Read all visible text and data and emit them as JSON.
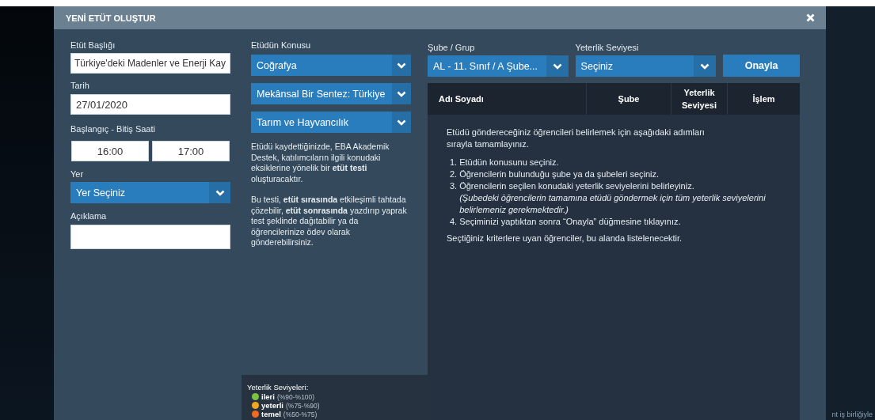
{
  "dialog": {
    "title": "YENİ ETÜT OLUŞTUR"
  },
  "form": {
    "title_field": {
      "label": "Etüt Başlığı",
      "value": "Türkiye'deki Madenler ve Enerji Kay"
    },
    "date_field": {
      "label": "Tarih",
      "value": "27/01/2020"
    },
    "time": {
      "label": "Başlangıç - Bitiş Saati",
      "start": "16:00",
      "end": "17:00"
    },
    "place": {
      "label": "Yer",
      "value": "Yer Seçiniz"
    },
    "description": {
      "label": "Açıklama"
    }
  },
  "topic": {
    "label": "Etüdün Konusu",
    "selects": [
      "Coğrafya",
      "Mekânsal Bir Sentez: Türkiye",
      "Tarım ve Hayvancılık"
    ],
    "info_paragraphs": [
      "Etüdü kaydettiğinizde, EBA Akademik Destek, katılımcıların ilgili konudaki eksiklerine yönelik bir **etüt testi** oluşturacaktır.",
      "Bu testi, **etüt sırasında** etkileşimli tahtada çözebilir, **etüt sonrasında** yazdırıp yaprak test şeklinde dağıtabilir ya da öğrencilerinize ödev olarak gönderebilirsiniz."
    ]
  },
  "filters": {
    "group": {
      "label": "Şube / Grup",
      "value": "AL - 11. Sınıf / A Şube..."
    },
    "level": {
      "label": "Yeterlik Seviyesi",
      "value": "Seçiniz"
    },
    "confirm_button": "Onayla"
  },
  "table": {
    "columns": [
      "Adı Soyadı",
      "Şube",
      "Yeterlik Seviyesi",
      "İşlem"
    ],
    "empty_message": {
      "intro": "Etüdü göndereceğiniz öğrencileri belirlemek için aşağıdaki adımları sırayla tamamlayınız.",
      "steps": [
        {
          "number": "1.",
          "text": "Etüdün konusunu seçiniz."
        },
        {
          "number": "2.",
          "text": "Öğrencilerin bulunduğu şube ya da şubeleri seçiniz."
        },
        {
          "number": "3.",
          "text": "Öğrencilerin seçilen konudaki yeterlik seviyelerini belirleyiniz.",
          "note": "(Şubedeki öğrencilerin tamamına etüdü göndermek için tüm yeterlik seviyelerini belirlemeniz gerekmektedir.)"
        },
        {
          "number": "4.",
          "text": "Seçiminizi yaptıktan sonra “Onayla” düğmesine tıklayınız."
        }
      ],
      "outro": "Seçtiğiniz kriterlere uyan öğrenciler, bu alanda listelenecektir."
    }
  },
  "legend": {
    "title": "Yeterlik Seviyeleri:",
    "items": [
      {
        "name": "ileri",
        "range": "(%90-%100)",
        "color": "#7cc242"
      },
      {
        "name": "yeterli",
        "range": "(%75-%90)",
        "color": "#f0a81e"
      },
      {
        "name": "temel",
        "range": "(%50-%75)",
        "color": "#ef6a22"
      }
    ]
  },
  "background_text": "nt iş birliğiyle"
}
